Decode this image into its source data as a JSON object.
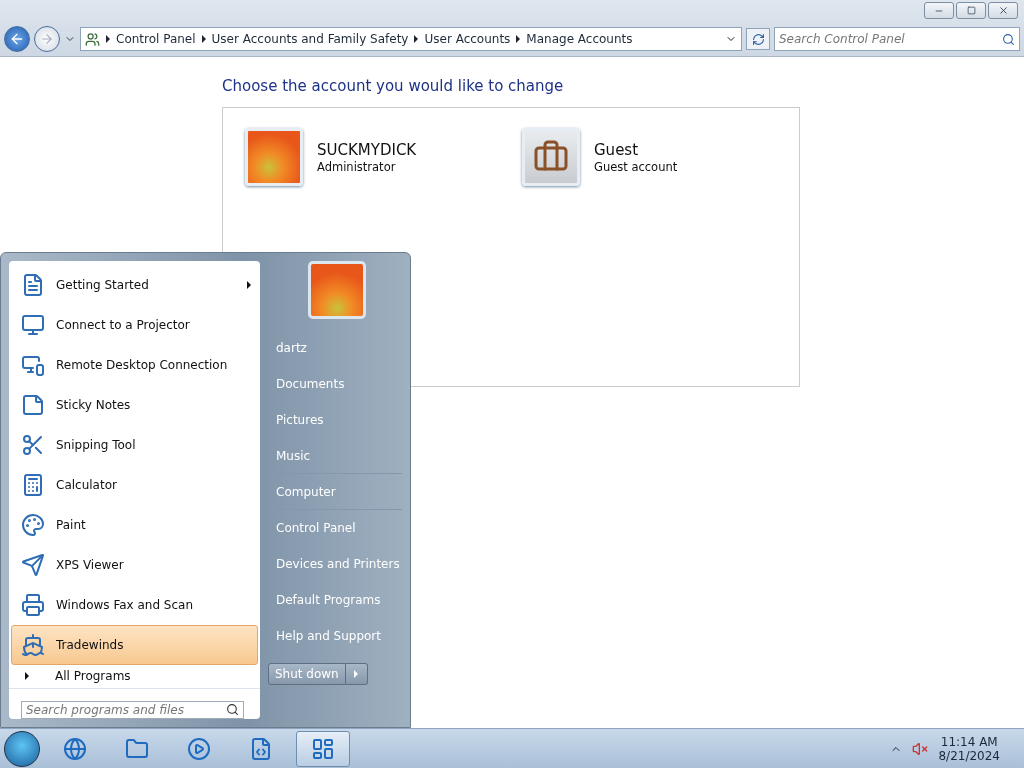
{
  "window": {
    "breadcrumb": [
      "Control Panel",
      "User Accounts and Family Safety",
      "User Accounts",
      "Manage Accounts"
    ],
    "search": {
      "placeholder": "Search Control Panel"
    },
    "heading": "Choose the account you would like to change",
    "accounts": [
      {
        "name": "SUCKMYDICK",
        "role": "Administrator",
        "kind": "flower"
      },
      {
        "name": "Guest",
        "role": "Guest account",
        "kind": "briefcase"
      }
    ]
  },
  "start_menu": {
    "programs": [
      {
        "label": "Getting Started",
        "kind": "document",
        "submenu": true,
        "selected": false
      },
      {
        "label": "Connect to a Projector",
        "kind": "projector",
        "submenu": false,
        "selected": false
      },
      {
        "label": "Remote Desktop Connection",
        "kind": "remote",
        "submenu": false,
        "selected": false
      },
      {
        "label": "Sticky Notes",
        "kind": "notes",
        "submenu": false,
        "selected": false
      },
      {
        "label": "Snipping Tool",
        "kind": "scissors",
        "submenu": false,
        "selected": false
      },
      {
        "label": "Calculator",
        "kind": "calculator",
        "submenu": false,
        "selected": false
      },
      {
        "label": "Paint",
        "kind": "palette",
        "submenu": false,
        "selected": false
      },
      {
        "label": "XPS Viewer",
        "kind": "plane",
        "submenu": false,
        "selected": false
      },
      {
        "label": "Windows Fax and Scan",
        "kind": "printer",
        "submenu": false,
        "selected": false
      },
      {
        "label": "Tradewinds",
        "kind": "ship",
        "submenu": false,
        "selected": true
      }
    ],
    "all_programs": "All Programs",
    "search": {
      "placeholder": "Search programs and files"
    },
    "places": [
      {
        "label": "dartz",
        "divider_before": false
      },
      {
        "label": "Documents",
        "divider_before": false
      },
      {
        "label": "Pictures",
        "divider_before": false
      },
      {
        "label": "Music",
        "divider_before": false
      },
      {
        "label": "Computer",
        "divider_before": true
      },
      {
        "label": "Control Panel",
        "divider_before": true
      },
      {
        "label": "Devices and Printers",
        "divider_before": false
      },
      {
        "label": "Default Programs",
        "divider_before": false
      },
      {
        "label": "Help and Support",
        "divider_before": false
      }
    ],
    "shutdown": "Shut down"
  },
  "taskbar": {
    "apps": [
      {
        "kind": "browser",
        "active": false
      },
      {
        "kind": "folder",
        "active": false
      },
      {
        "kind": "media",
        "active": false
      },
      {
        "kind": "notepad",
        "active": false
      },
      {
        "kind": "control-panel",
        "active": true
      }
    ],
    "time": "11:14 AM",
    "date": "8/21/2024"
  }
}
